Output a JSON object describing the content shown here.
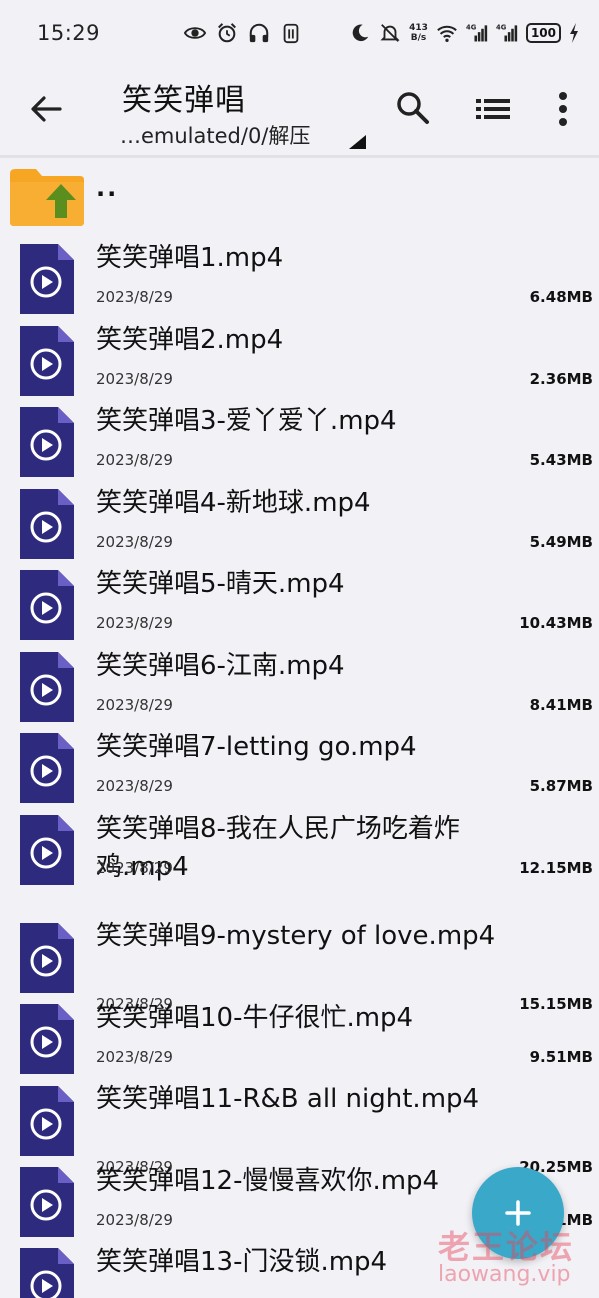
{
  "status_bar": {
    "time": "15:29",
    "net_speed_value": "413",
    "net_speed_unit": "B/s",
    "signal1_label": "4G",
    "signal2_label": "4G",
    "battery": "100",
    "left_icons": [
      "eye-icon",
      "alarm-icon",
      "headphones-icon",
      "sim-icon"
    ],
    "right_icons": [
      "moon-icon",
      "mute-icon",
      "wifi-icon",
      "signal-icon",
      "signal-icon",
      "charging-icon"
    ]
  },
  "app_bar": {
    "title": "笑笑弹唱",
    "path": "…emulated/0/解压",
    "icons": [
      "back-arrow-icon",
      "search-icon",
      "list-view-icon",
      "more-vert-icon"
    ]
  },
  "parent_folder": {
    "label": ".."
  },
  "files": [
    {
      "name": "笑笑弹唱1.mp4",
      "date": "2023/8/29",
      "size": "6.48MB"
    },
    {
      "name": "笑笑弹唱2.mp4",
      "date": "2023/8/29",
      "size": "2.36MB"
    },
    {
      "name": "笑笑弹唱3-爱丫爱丫.mp4",
      "date": "2023/8/29",
      "size": "5.43MB"
    },
    {
      "name": "笑笑弹唱4-新地球.mp4",
      "date": "2023/8/29",
      "size": "5.49MB"
    },
    {
      "name": "笑笑弹唱5-晴天.mp4",
      "date": "2023/8/29",
      "size": "10.43MB"
    },
    {
      "name": "笑笑弹唱6-江南.mp4",
      "date": "2023/8/29",
      "size": "8.41MB"
    },
    {
      "name": "笑笑弹唱7-letting go.mp4",
      "date": "2023/8/29",
      "size": "5.87MB"
    },
    {
      "name": "笑笑弹唱8-我在人民广场吃着炸鸡.mp4",
      "date": "2023/8/29",
      "size": "12.15MB"
    },
    {
      "name": "笑笑弹唱9-mystery of love.mp4",
      "date": "2023/8/29",
      "size": "15.15MB"
    },
    {
      "name": "笑笑弹唱10-牛仔很忙.mp4",
      "date": "2023/8/29",
      "size": "9.51MB"
    },
    {
      "name": "笑笑弹唱11-R&B all night.mp4",
      "date": "2023/8/29",
      "size": "20.25MB"
    },
    {
      "name": "笑笑弹唱12-慢慢喜欢你.mp4",
      "date": "2023/8/29",
      "size": "1MB"
    },
    {
      "name": "笑笑弹唱13-门没锁.mp4",
      "date": "",
      "size": ""
    }
  ],
  "fab": {
    "label": "+"
  },
  "watermark": {
    "cn": "老王论坛",
    "en": "laowang.vip"
  },
  "colors": {
    "video_icon": "#2e2a7e",
    "video_fold": "#6a5fc4",
    "folder": "#f6a623",
    "folder_arrow": "#5a8f1f",
    "fab": "#3aa8c8"
  }
}
